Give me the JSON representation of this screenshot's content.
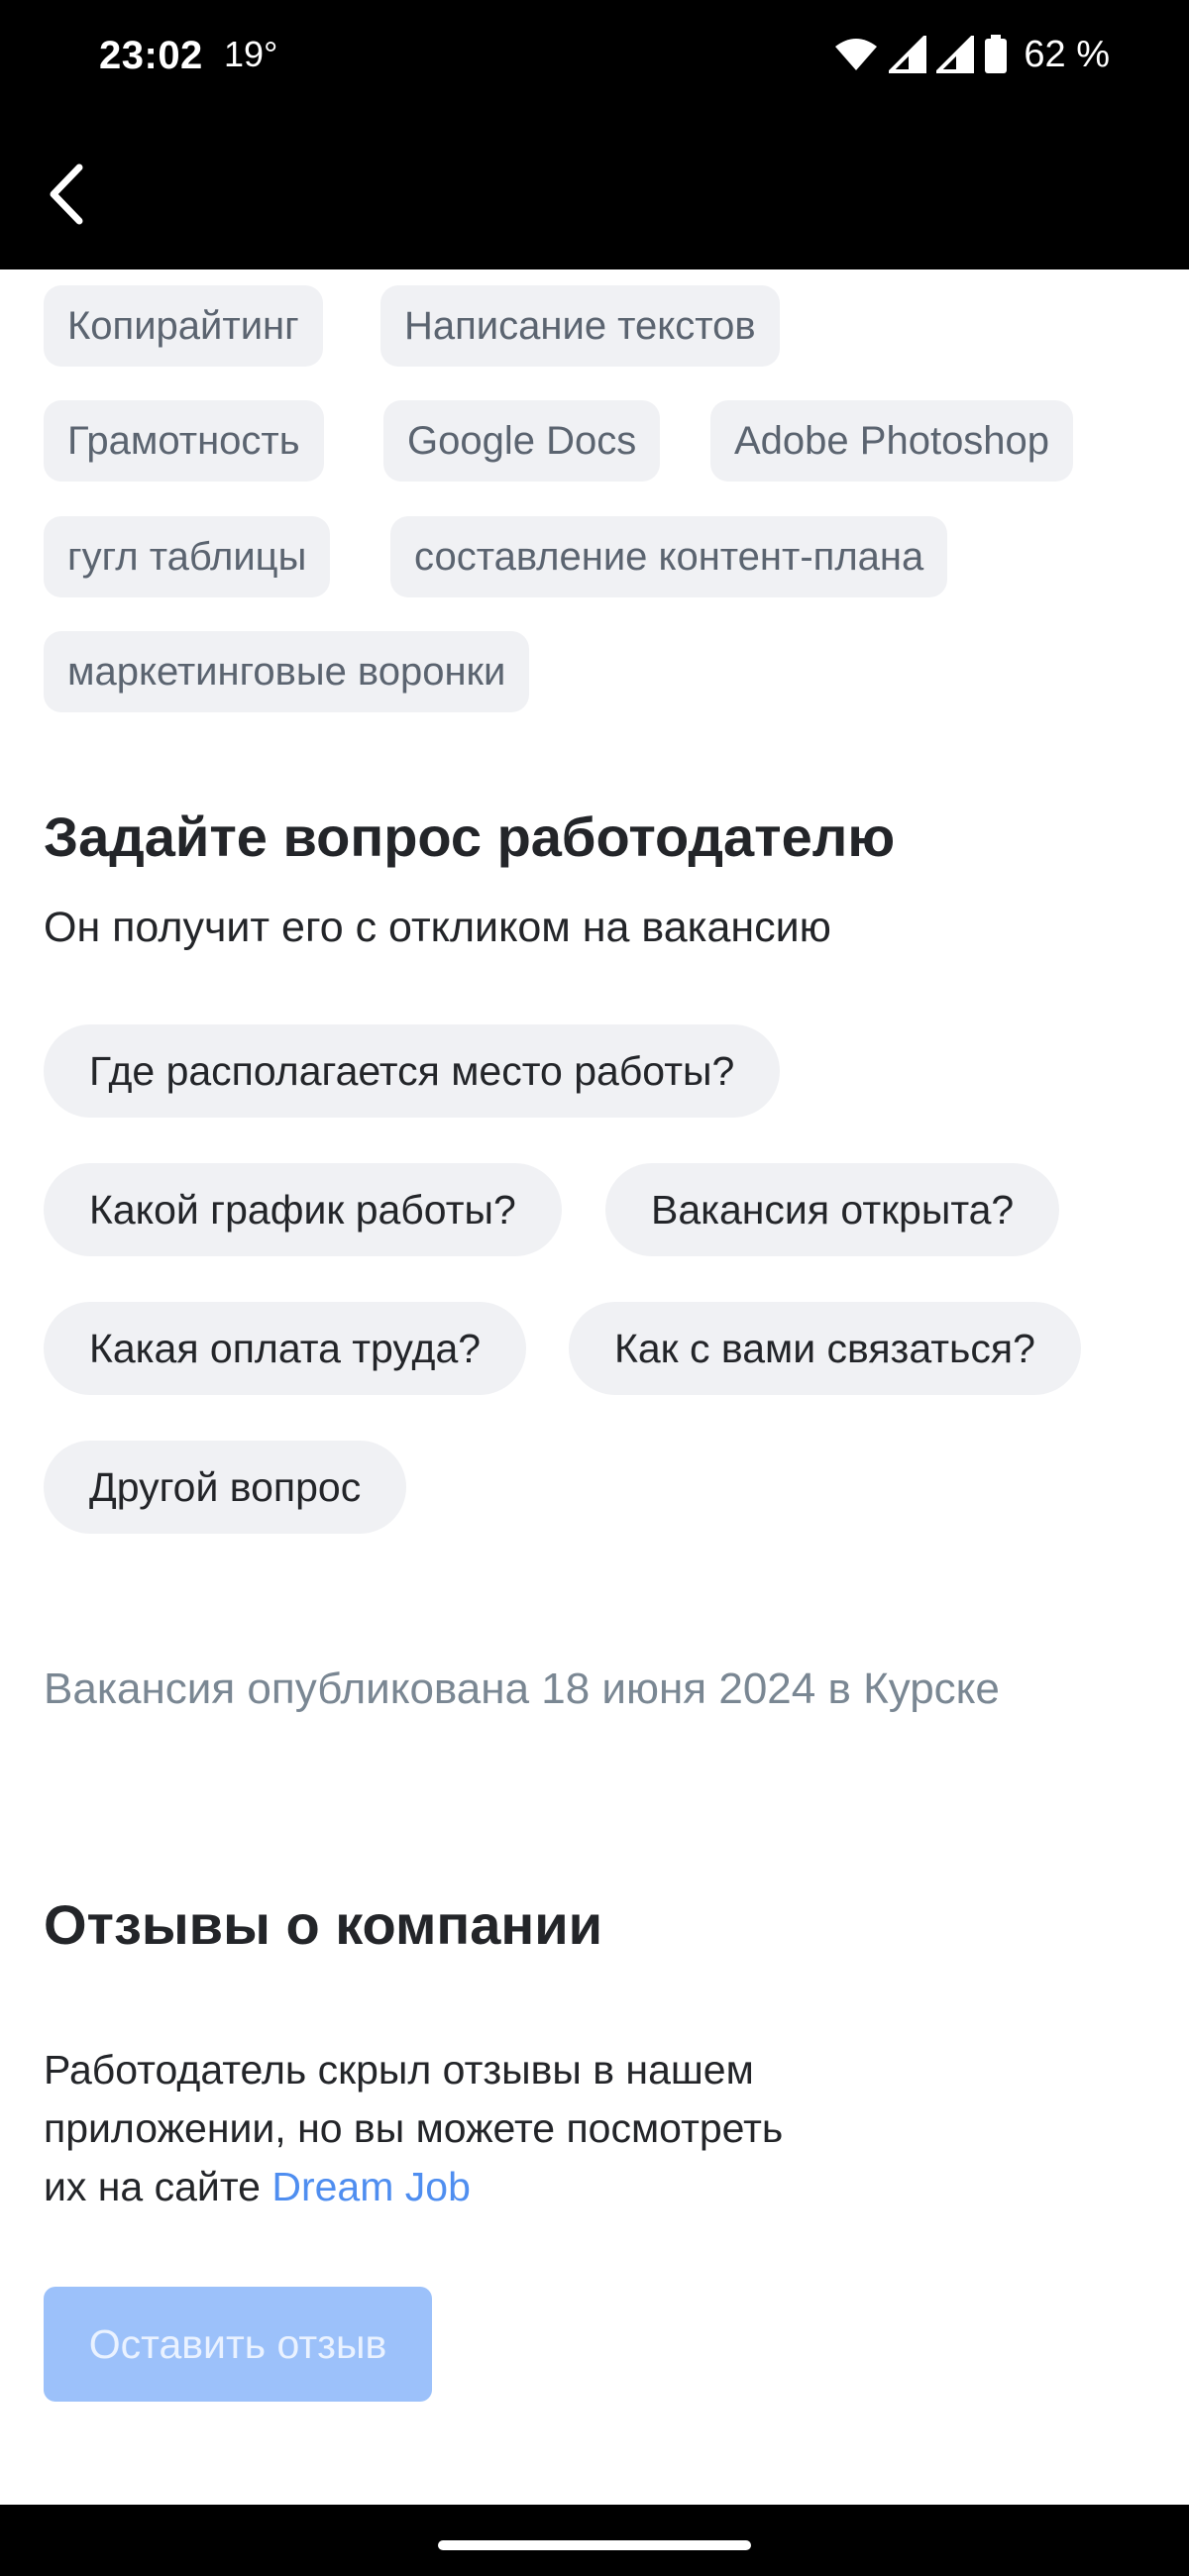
{
  "status": {
    "time": "23:02",
    "temp": "19°",
    "battery": "62 %",
    "icons": [
      "wifi-icon",
      "signal-icon",
      "signal-icon",
      "battery-icon"
    ]
  },
  "app_bar": {
    "back_icon": "chevron-left-icon"
  },
  "skills": [
    "Копирайтинг",
    "Написание текстов",
    "Грамотность",
    "Google Docs",
    "Adobe Photoshop",
    "гугл таблицы",
    "составление контент-плана",
    "маркетинговые воронки"
  ],
  "ask": {
    "title": "Задайте вопрос работодателю",
    "subtitle": "Он получит его с откликом на вакансию",
    "questions": [
      "Где располагается место работы?",
      "Какой график работы?",
      "Вакансия открыта?",
      "Какая оплата труда?",
      "Как с вами связаться?",
      "Другой вопрос"
    ]
  },
  "published": "Вакансия опубликована 18 июня 2024 в Курске",
  "reviews": {
    "title": "Отзывы о компании",
    "text_line1": "Работодатель скрыл отзывы в нашем",
    "text_line2": "приложении, но вы можете посмотреть",
    "text_line3_prefix": "их на сайте ",
    "link": "Dream Job",
    "button": "Оставить отзыв"
  },
  "colors": {
    "chip_bg": "#f0f1f4",
    "link": "#4f8ef0",
    "button_disabled": "#9cc1fa",
    "muted_text": "#7a8793"
  }
}
